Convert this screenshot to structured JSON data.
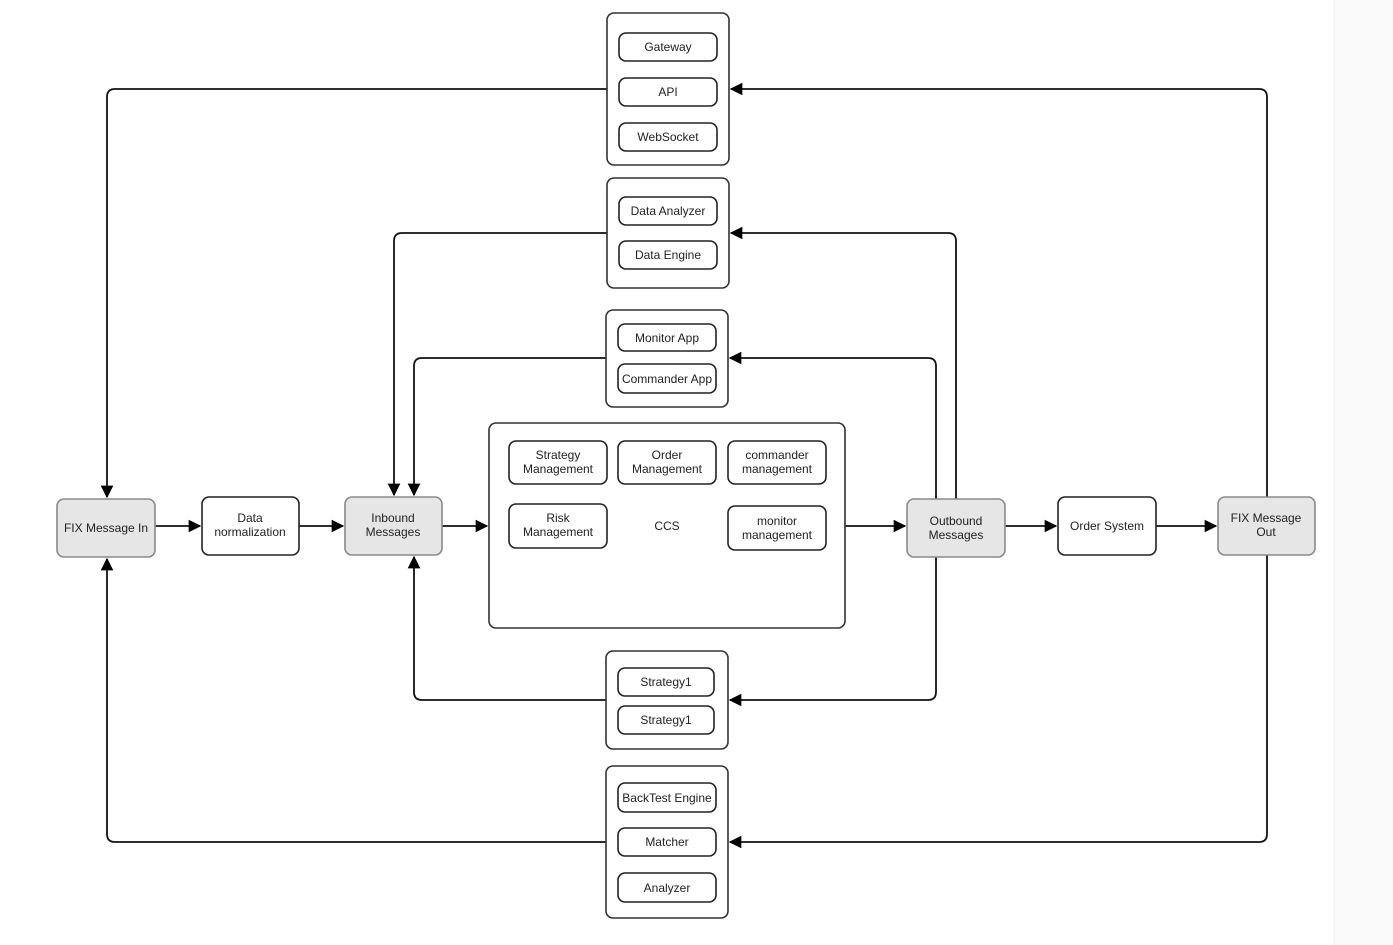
{
  "diagram": {
    "fix_in": [
      "FIX Message In"
    ],
    "data_normalization": [
      "Data",
      "normalization"
    ],
    "inbound": [
      "Inbound",
      "Messages"
    ],
    "outbound": [
      "Outbound",
      "Messages"
    ],
    "order_system": [
      "Order System"
    ],
    "fix_out": [
      "FIX Message",
      "Out"
    ],
    "gateway_group": [
      "Gateway",
      "API",
      "WebSocket"
    ],
    "data_group": [
      "Data Analyzer",
      "Data Engine"
    ],
    "monitor_group": [
      "Monitor App",
      "Commander App"
    ],
    "ccs": {
      "label": "CCS",
      "strategy_management": [
        "Strategy",
        "Management"
      ],
      "order_management": [
        "Order",
        "Management"
      ],
      "commander_management": [
        "commander",
        "management"
      ],
      "risk_management": [
        "Risk",
        "Management"
      ],
      "monitor_management": [
        "monitor",
        "management"
      ]
    },
    "strategy_group": [
      "Strategy1",
      "Strategy1"
    ],
    "backtest_group": [
      "BackTest Engine",
      "Matcher",
      "Analyzer"
    ],
    "colors": {
      "highlight_fill": "#e6e6e6",
      "stroke": "#222222"
    }
  }
}
